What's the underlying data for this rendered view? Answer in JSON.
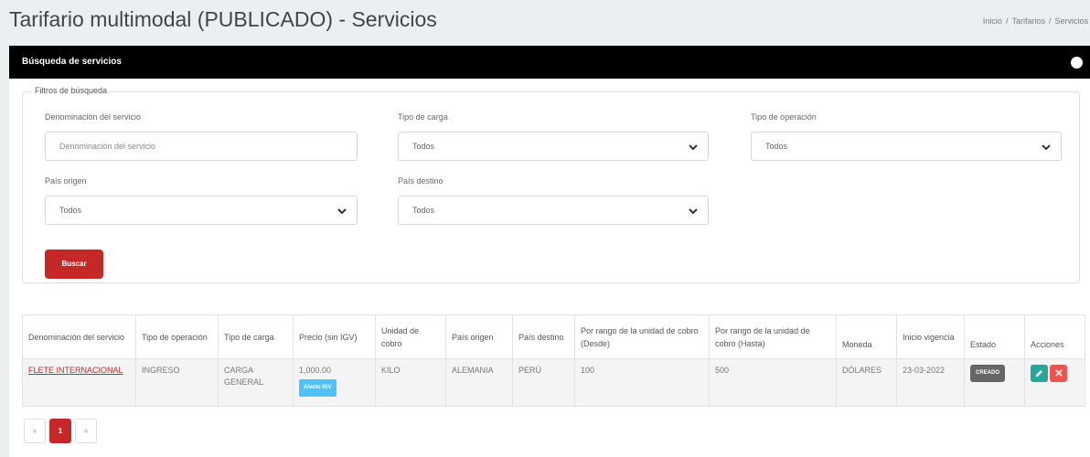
{
  "header": {
    "title": "Tarifario multimodal (PUBLICADO) - Servicios",
    "breadcrumb": [
      "Inicio",
      "Tarifarios",
      "Servicios"
    ]
  },
  "panel": {
    "title": "Búsqueda de servicios"
  },
  "filters": {
    "legend": "Filtros de búsqueda",
    "service_name": {
      "label": "Denominación del servicio",
      "placeholder": "Denominación del servicio"
    },
    "cargo_type": {
      "label": "Tipo de carga",
      "value": "Todos"
    },
    "operation_type": {
      "label": "Tipo de operación",
      "value": "Todos"
    },
    "origin_country": {
      "label": "País origen",
      "value": "Todos"
    },
    "destination_country": {
      "label": "País destino",
      "value": "Todos"
    },
    "search_label": "Buscar"
  },
  "table": {
    "headers": [
      "Denominación del servicio",
      "Tipo de operación",
      "Tipo de carga",
      "Precio (sin IGV)",
      "Unidad de cobro",
      "País origen",
      "País destino",
      "Por rango de la unidad de cobro (Desde)",
      "Por rango de la unidad de cobro (Hasta)",
      "Moneda",
      "Inicio vigencia",
      "Estado",
      "Acciones"
    ],
    "rows": [
      {
        "service": "FLETE INTERNACIONAL",
        "operation": "INGRESO",
        "cargo": "CARGA GENERAL",
        "price": "1,000.00",
        "price_badge": "Afecto IGV",
        "unit": "KILO",
        "origin": "ALEMANIA",
        "destination": "PERÚ",
        "from": "100",
        "to": "500",
        "currency": "DÓLARES",
        "start": "23-03-2022",
        "state": "CREADO"
      }
    ]
  },
  "pagination": {
    "prev": "«",
    "current": "1",
    "next": "»"
  },
  "colors": {
    "accent": "#c62828",
    "header_bar": "#000000",
    "edit": "#26a69a",
    "delete": "#ef5350",
    "igv_badge": "#4fc3f7",
    "state_badge": "#666666"
  },
  "icons": {
    "collapse": "circle-icon",
    "chevron": "chevron-down-icon",
    "edit": "pencil-icon",
    "delete": "close-icon"
  }
}
